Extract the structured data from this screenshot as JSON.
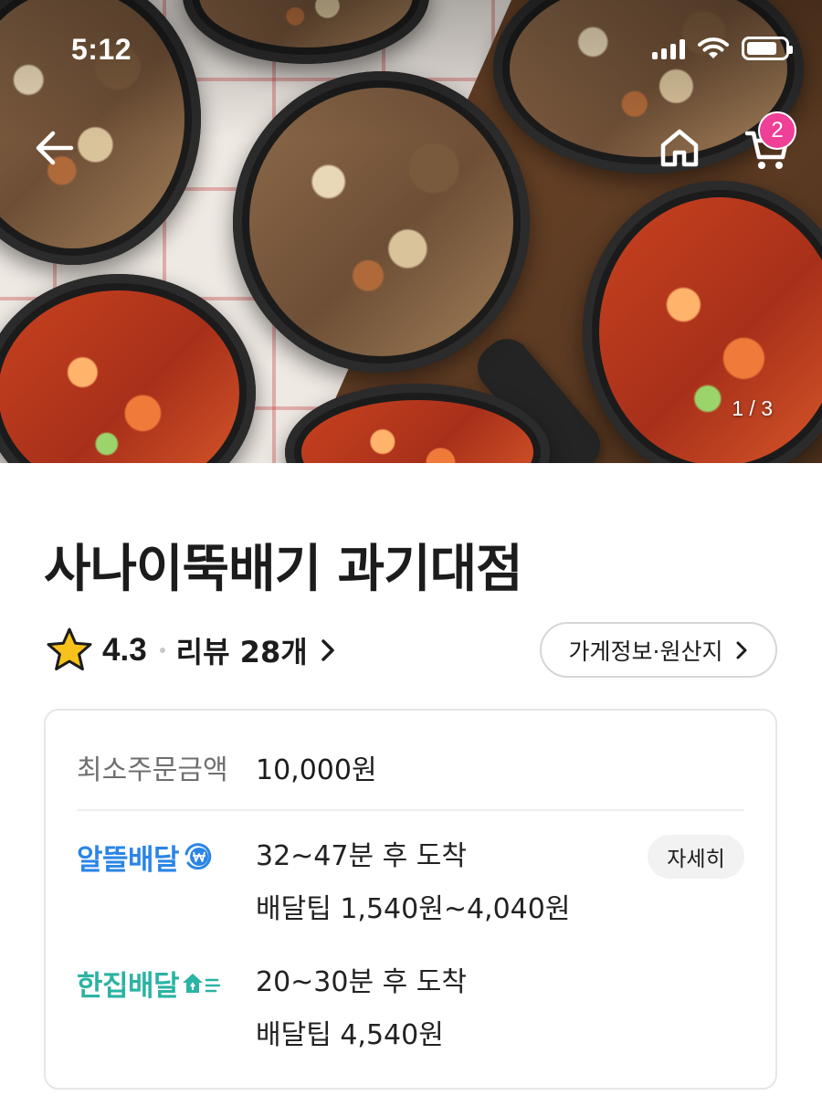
{
  "status_bar": {
    "time": "5:12"
  },
  "hero": {
    "image_counter": "1 / 3",
    "cart_count": "2"
  },
  "store": {
    "name": "사나이뚝배기 과기대점",
    "rating": "4.3",
    "review_label": "리뷰 28개",
    "info_button": "가게정보·원산지"
  },
  "order_info": {
    "min_order_label": "최소주문금액",
    "min_order_value": "10,000원",
    "options": [
      {
        "logo": "알뜰배달",
        "logo_color": "#2b85e6",
        "time": "32~47분 후 도착",
        "tip": "배달팁 1,540원~4,040원",
        "detail_button": "자세히"
      },
      {
        "logo": "한집배달",
        "logo_color": "#2bb3a3",
        "time": "20~30분 후 도착",
        "tip": "배달팁 4,540원"
      }
    ]
  },
  "colors": {
    "badge": "#ef3f97",
    "star": "#f7c21b"
  },
  "icons": [
    "back-arrow-icon",
    "home-icon",
    "cart-icon",
    "star-icon",
    "chevron-right-icon",
    "won-coin-icon",
    "house-speed-icon",
    "signal-icon",
    "wifi-icon",
    "battery-icon"
  ]
}
